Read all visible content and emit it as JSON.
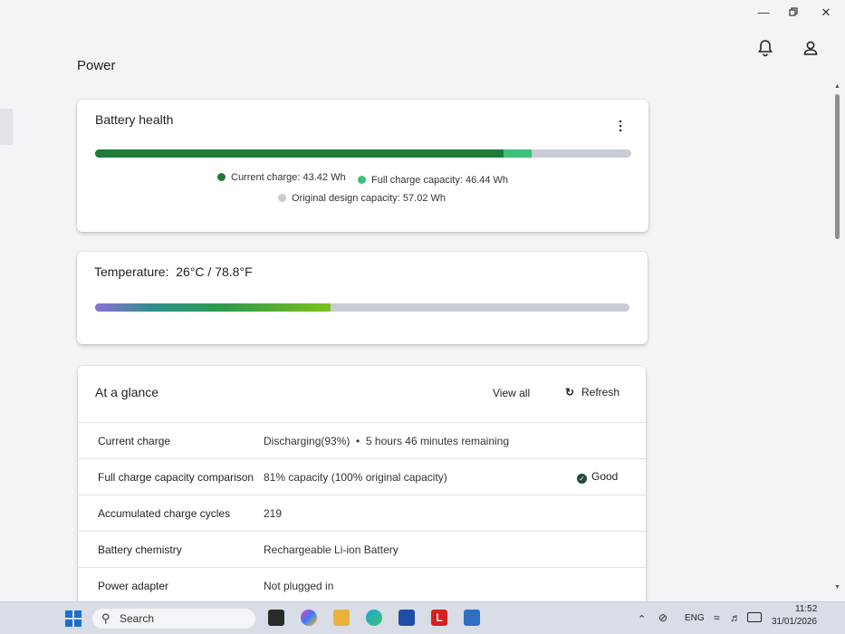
{
  "header": {
    "title": "Power",
    "icons": [
      "bell-icon",
      "user-icon"
    ]
  },
  "window_controls": [
    "minimize-icon",
    "restore-icon",
    "close-icon"
  ],
  "battery_health": {
    "title": "Battery health",
    "more_icon": "more-vertical-icon",
    "current_charge_label": "Current charge:",
    "current_charge_value": "43.42 Wh",
    "full_charge_label": "Full charge capacity:",
    "full_charge_value": "46.44 Wh",
    "design_label": "Original design capacity:",
    "design_value": "57.02 Wh",
    "current_wh": 43.42,
    "full_wh": 46.44,
    "design_wh": 57.02,
    "colors": {
      "current": "#1e7a3c",
      "full": "#3cc07a",
      "design": "#c7ccd5"
    }
  },
  "temperature": {
    "label": "Temperature:",
    "value": "26°C / 78.8°F",
    "level_fraction": 0.44
  },
  "glance": {
    "title": "At a glance",
    "view_all": "View all",
    "refresh": "Refresh",
    "rows": [
      {
        "label": "Current charge",
        "value": "Discharging(93%)",
        "extra": "5 hours 46 minutes remaining"
      },
      {
        "label": "Full charge capacity comparison",
        "value": "81% capacity (100% original capacity)",
        "status": "Good"
      },
      {
        "label": "Accumulated charge cycles",
        "value": "219"
      },
      {
        "label": "Battery chemistry",
        "value": "Rechargeable Li-ion Battery"
      },
      {
        "label": "Power adapter",
        "value": "Not plugged in"
      }
    ]
  },
  "taskbar": {
    "search_placeholder": "Search",
    "language": "ENG",
    "time": "11:52",
    "date": "31/01/2026"
  }
}
